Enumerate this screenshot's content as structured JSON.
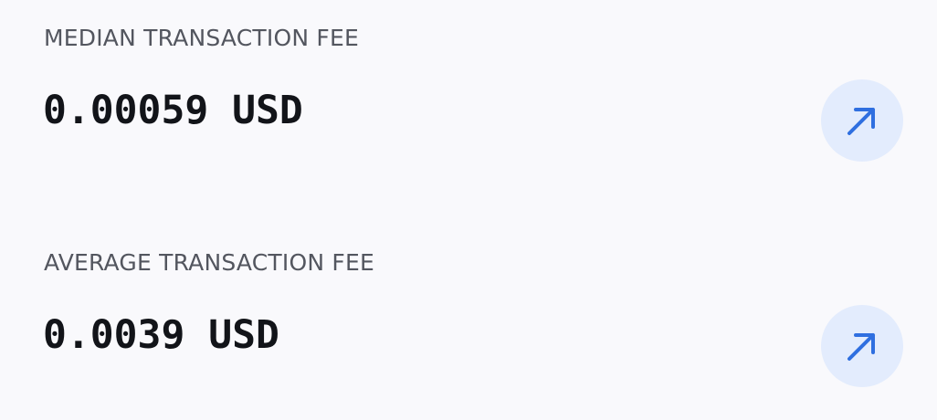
{
  "stats": [
    {
      "label": "MEDIAN TRANSACTION FEE",
      "value": "0.00059 USD",
      "button_icon": "arrow-up-right-icon"
    },
    {
      "label": "AVERAGE TRANSACTION FEE",
      "value": "0.0039 USD",
      "button_icon": "arrow-up-right-icon"
    }
  ],
  "colors": {
    "background": "#f9f9fc",
    "label": "#53565f",
    "value": "#121419",
    "button_bg": "#e3ecfd",
    "accent": "#2f6fe0"
  }
}
